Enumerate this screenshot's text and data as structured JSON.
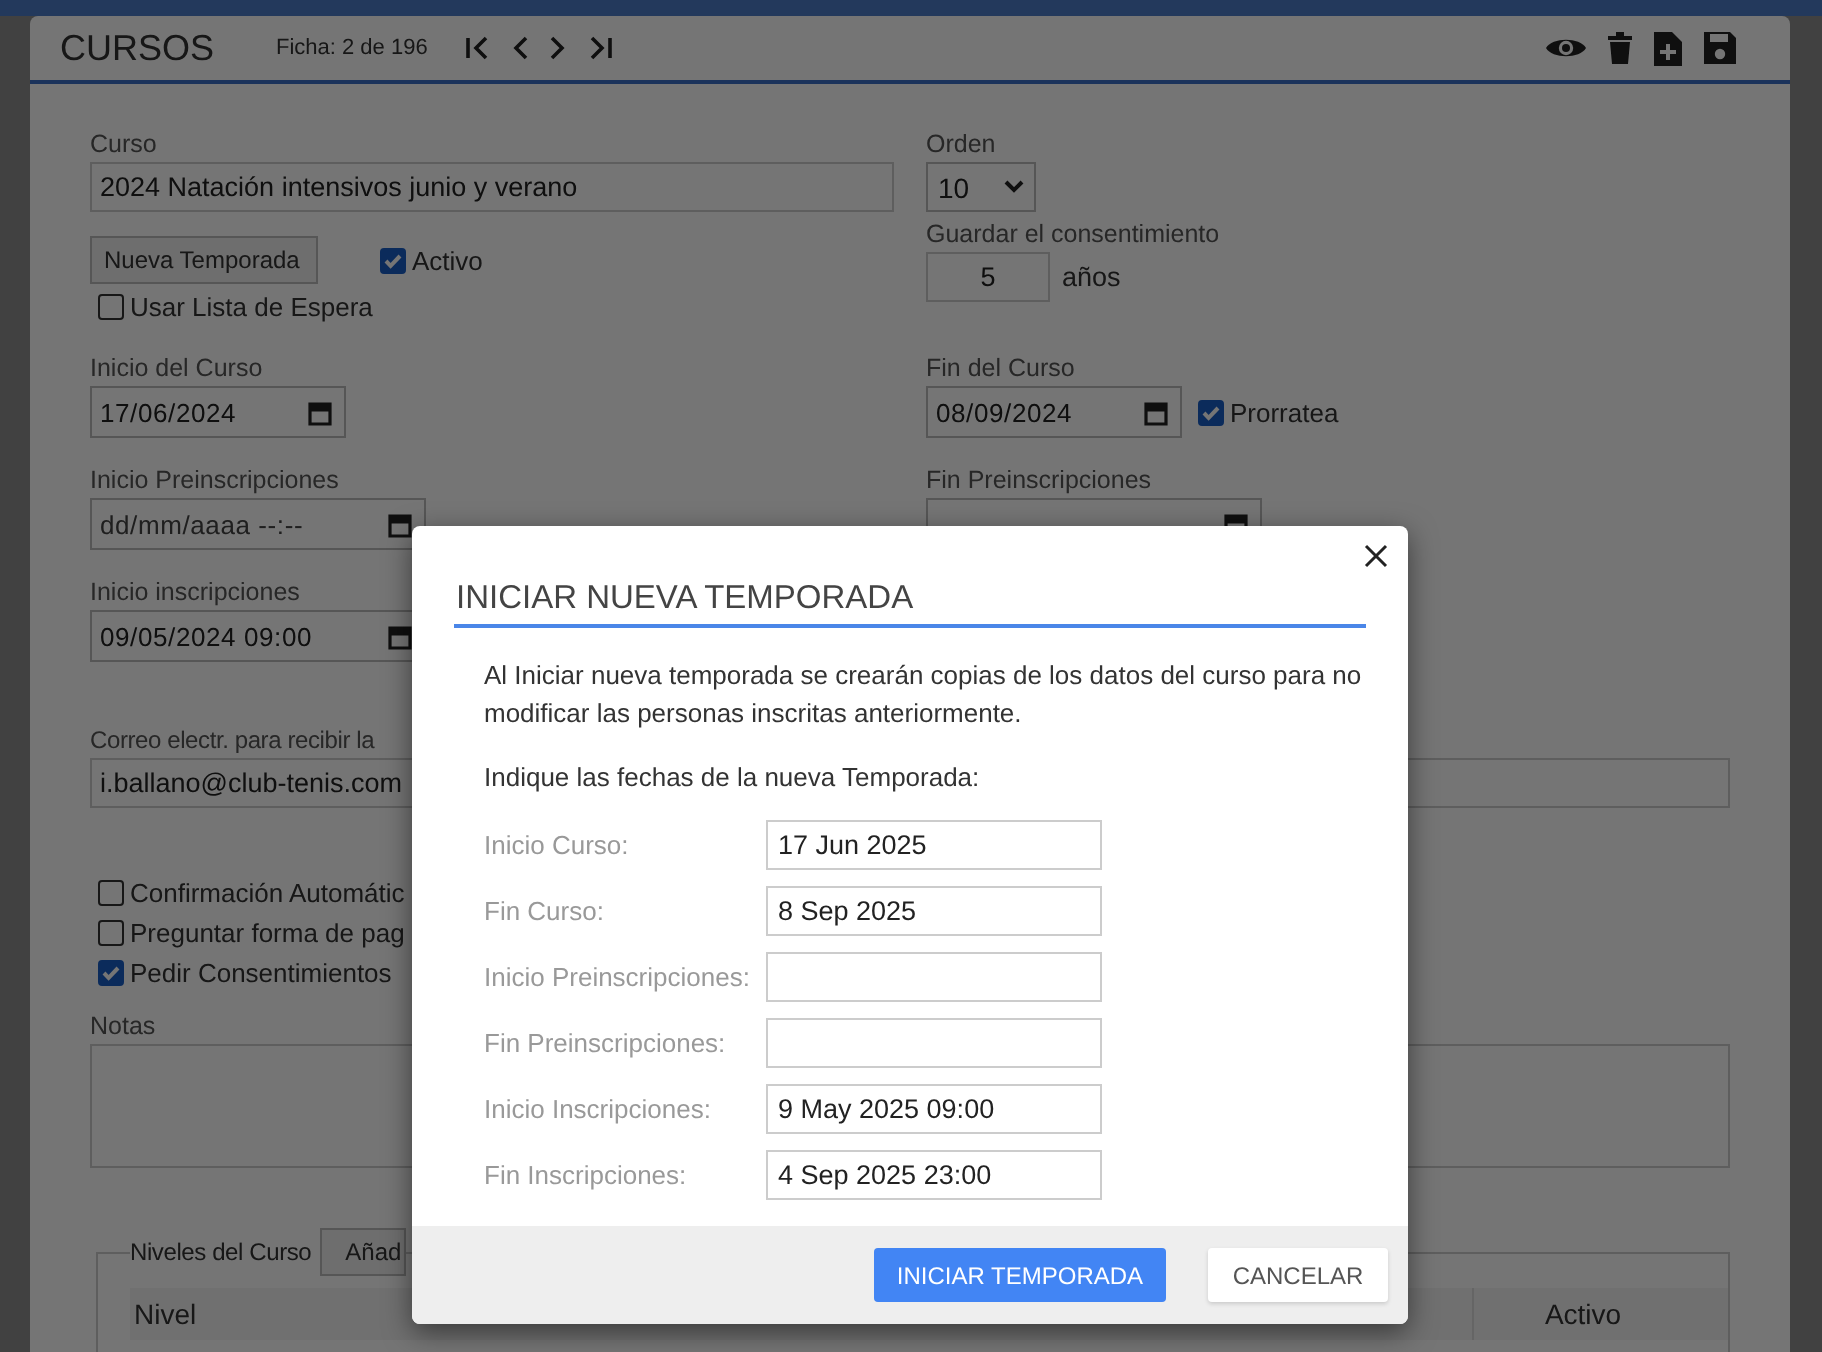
{
  "page": {
    "title": "CURSOS",
    "record": "Ficha: 2 de 196"
  },
  "form": {
    "curso": {
      "label": "Curso",
      "value": "2024 Natación intensivos junio y verano"
    },
    "orden": {
      "label": "Orden",
      "value": "10"
    },
    "new_season_button": "Nueva Temporada",
    "activo": {
      "label": "Activo",
      "checked": true
    },
    "waiting_list": {
      "label": "Usar Lista de Espera",
      "checked": false
    },
    "consent": {
      "label": "Guardar el consentimiento",
      "value": "5",
      "unit": "años"
    },
    "course_start": {
      "label": "Inicio del Curso",
      "value": "17/06/2024"
    },
    "course_end": {
      "label": "Fin del Curso",
      "value": "08/09/2024"
    },
    "prorate": {
      "label": "Prorratea",
      "checked": true
    },
    "prereg_start": {
      "label": "Inicio Preinscripciones",
      "placeholder": "dd/mm/aaaa --:--"
    },
    "prereg_end": {
      "label": "Fin Preinscripciones"
    },
    "reg_start": {
      "label": "Inicio inscripciones",
      "value": "09/05/2024 09:00"
    },
    "email": {
      "label": "Correo electr. para recibir la",
      "value": "i.ballano@club-tenis.com"
    },
    "options": [
      {
        "label": "Confirmación Automátic",
        "checked": false
      },
      {
        "label": "Preguntar forma de pag",
        "checked": false
      },
      {
        "label": "Pedir Consentimientos",
        "checked": true
      }
    ],
    "notes": {
      "label": "Notas"
    },
    "levels": {
      "legend": "Niveles del Curso",
      "add_button": "Añad",
      "columns": [
        "Nivel",
        "Activo"
      ]
    }
  },
  "dialog": {
    "title": "INICIAR NUEVA TEMPORADA",
    "message": "Al Iniciar nueva temporada se crearán copias de los datos del curso para no modificar las personas inscritas anteriormente.",
    "prompt": "Indique las fechas de la nueva Temporada:",
    "fields": [
      {
        "label": "Inicio Curso:",
        "value": "17 Jun 2025"
      },
      {
        "label": "Fin Curso:",
        "value": "8 Sep 2025"
      },
      {
        "label": "Inicio Preinscripciones:"
      },
      {
        "label": "Fin Preinscripciones:"
      },
      {
        "label": "Inicio Inscripciones:",
        "value": "9 May 2025 09:00"
      },
      {
        "label": "Fin Inscripciones:",
        "value": "4 Sep 2025 23:00"
      }
    ],
    "buttons": [
      {
        "label": "INICIAR TEMPORADA",
        "kind": "primary"
      },
      {
        "label": "CANCELAR",
        "kind": "secondary"
      }
    ]
  }
}
